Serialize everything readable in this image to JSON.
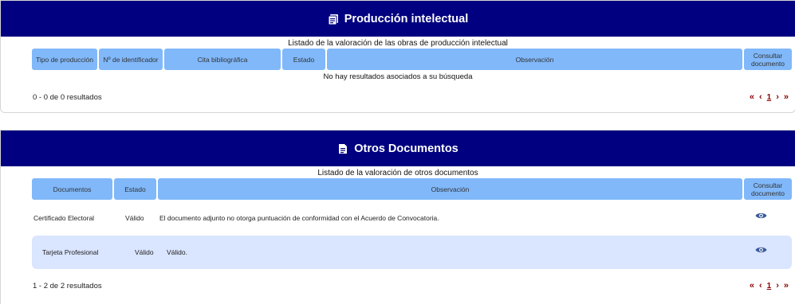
{
  "section_intelectual": {
    "title": "Producción intelectual",
    "caption": "Listado de la valoración de las obras de producción intelectual",
    "columns": [
      "Tipo de producción",
      "Nº de identificador",
      "Cita bibliográfica",
      "Estado",
      "Observación",
      "Consultar documento"
    ],
    "empty_message": "No hay resultados asociados a su búsqueda",
    "results_text": "0 - 0 de 0 resultados",
    "pager": {
      "first": "«",
      "prev": "‹",
      "page": "1",
      "next": "›",
      "last": "»"
    }
  },
  "section_otros": {
    "title": "Otros Documentos",
    "caption": "Listado de la valoración de otros documentos",
    "columns": [
      "Documentos",
      "Estado",
      "Observación",
      "Consultar documento"
    ],
    "rows": [
      {
        "documento": "Certificado Electoral",
        "estado": "Válido",
        "observacion": "El documento adjunto no otorga puntuación de conformidad con el Acuerdo de Convocatoria."
      },
      {
        "documento": "Tarjeta Profesional",
        "estado": "Válido",
        "observacion": "Válido."
      }
    ],
    "results_text": "1 - 2 de 2 resultados",
    "pager": {
      "first": "«",
      "prev": "‹",
      "page": "1",
      "next": "›",
      "last": "»"
    }
  },
  "colors": {
    "header_bg": "#000080",
    "column_bg": "#80b8fa",
    "alt_row_bg": "#dae5ff",
    "pager": "#8b0000",
    "eye_icon": "#3a5a9a"
  },
  "icons": {
    "intelectual_header": "document-list-icon",
    "otros_header": "file-text-icon",
    "consult": "eye-icon"
  }
}
